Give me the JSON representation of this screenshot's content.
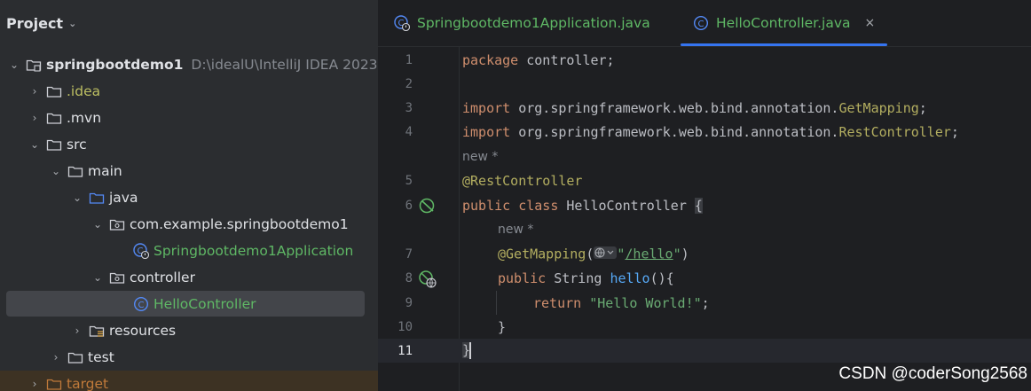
{
  "project_panel": {
    "title": "Project",
    "tree": [
      {
        "label": "springbootdemo1",
        "hint": "D:\\idealU\\IntelliJ IDEA 2023"
      },
      {
        "label": ".idea"
      },
      {
        "label": ".mvn"
      },
      {
        "label": "src"
      },
      {
        "label": "main"
      },
      {
        "label": "java"
      },
      {
        "label": "com.example.springbootdemo1"
      },
      {
        "label": "Springbootdemo1Application"
      },
      {
        "label": "controller"
      },
      {
        "label": "HelloController"
      },
      {
        "label": "resources"
      },
      {
        "label": "test"
      },
      {
        "label": "target"
      }
    ]
  },
  "editor": {
    "tabs": [
      {
        "label": "Springbootdemo1Application.java"
      },
      {
        "label": "HelloController.java",
        "close": "×"
      }
    ],
    "lines": {
      "n1": "1",
      "n2": "2",
      "n3": "3",
      "n4": "4",
      "n5": "5",
      "n6": "6",
      "n7": "7",
      "n8": "8",
      "n9": "9",
      "n10": "10",
      "n11": "11"
    },
    "code": {
      "l1_kw": "package",
      "l1_rest": " controller;",
      "l3_kw": "import",
      "l3_pkg": " org.springframework.web.bind.annotation.",
      "l3_cls": "GetMapping",
      "l3_end": ";",
      "l4_kw": "import",
      "l4_pkg": " org.springframework.web.bind.annotation.",
      "l4_cls": "RestController",
      "l4_end": ";",
      "hint_new_1": "new *",
      "l5_ann": "@RestController",
      "l6_kw": "public class",
      "l6_name": " HelloController ",
      "l6_brace": "{",
      "hint_new_2": "new *",
      "l7_ann": "@GetMapping",
      "l7_open": "(",
      "l7_q1": "\"",
      "l7_url": "/hello",
      "l7_q2": "\"",
      "l7_close": ")",
      "l8_kw": "public",
      "l8_type": " String ",
      "l8_fn": "hello",
      "l8_rest": "(){",
      "l9_kw": "return",
      "l9_str": " \"Hello World!\"",
      "l9_end": ";",
      "l10": "}",
      "l11": "}"
    }
  },
  "watermark": "CSDN @coderSong2568"
}
